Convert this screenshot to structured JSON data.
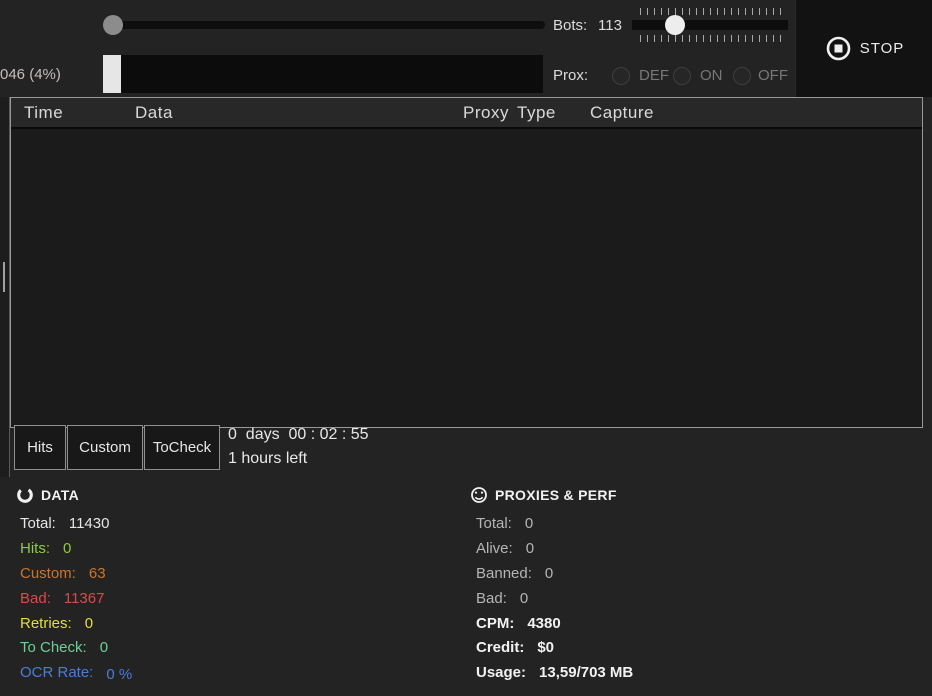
{
  "top_bar": {
    "progress_label": "046 (4%)",
    "progress_percent": 4,
    "bots_label": "Bots:",
    "bots_value": "113",
    "bots_slider_percent": 30,
    "prox_label": "Prox:",
    "proxy_options": [
      "DEF",
      "ON",
      "OFF"
    ],
    "stop_label": "STOP"
  },
  "icons": {
    "stop": "stop-circle-icon",
    "data_section": "ring-chart-icon",
    "proxies_section": "gauge-icon"
  },
  "table": {
    "columns": [
      "Time",
      "Data",
      "Proxy",
      "Type",
      "Capture"
    ],
    "rows": []
  },
  "tabs": [
    "Hits",
    "Custom",
    "ToCheck"
  ],
  "timer": {
    "elapsed": "0  days  00 : 02 : 55",
    "remaining": "1 hours left"
  },
  "stats": {
    "data": {
      "title": "DATA",
      "rows": [
        {
          "label": "Total:",
          "value": "11430",
          "color": "#e6e6e6"
        },
        {
          "label": "Hits:",
          "value": "0",
          "color": "#8ecb3d"
        },
        {
          "label": "Custom:",
          "value": "63",
          "color": "#cd7429"
        },
        {
          "label": "Bad:",
          "value": "11367",
          "color": "#da4a4a"
        },
        {
          "label": "Retries:",
          "value": "0",
          "color": "#e4df38"
        },
        {
          "label": "To Check:",
          "value": "0",
          "color": "#6fd095"
        },
        {
          "label": "OCR Rate:",
          "value": "0 %",
          "color": "#4a7dde"
        }
      ]
    },
    "proxies": {
      "title": "PROXIES & PERF",
      "rows": [
        {
          "label": "Total:",
          "value": "0",
          "bold": false
        },
        {
          "label": "Alive:",
          "value": "0",
          "bold": false
        },
        {
          "label": "Banned:",
          "value": "0",
          "bold": false
        },
        {
          "label": "Bad:",
          "value": "0",
          "bold": false
        },
        {
          "label": "CPM:",
          "value": "4380",
          "bold": true
        },
        {
          "label": "Credit:",
          "value": "$0",
          "bold": true
        },
        {
          "label": "Usage:",
          "value": "13,59/703 MB",
          "bold": true
        }
      ]
    }
  }
}
